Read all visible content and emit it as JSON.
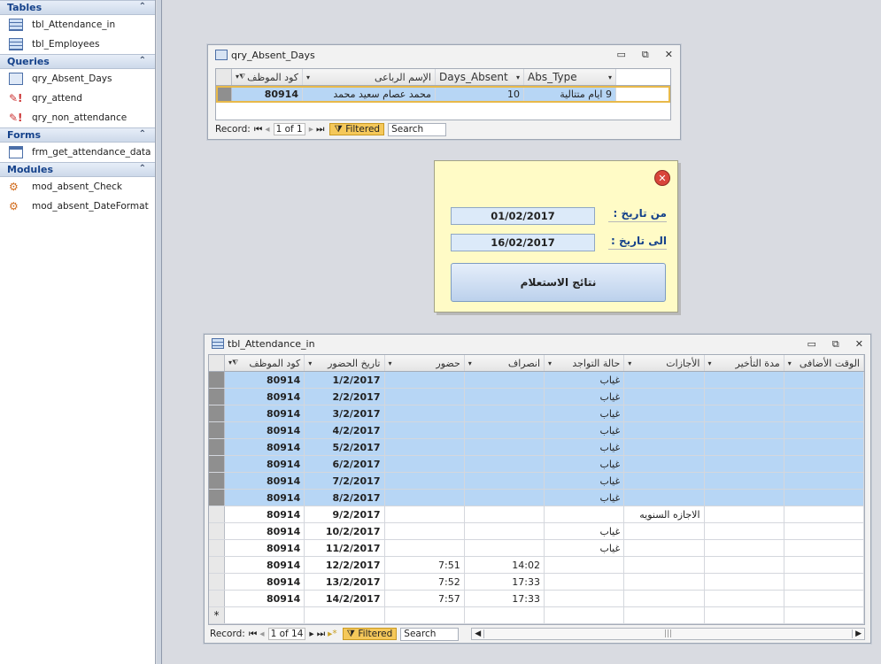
{
  "nav": {
    "tables_header": "Tables",
    "tables": [
      "tbl_Attendance_in",
      "tbl_Employees"
    ],
    "queries_header": "Queries",
    "queries": [
      "qry_Absent_Days",
      "qry_attend",
      "qry_non_attendance"
    ],
    "forms_header": "Forms",
    "forms": [
      "frm_get_attendance_data"
    ],
    "modules_header": "Modules",
    "modules": [
      "mod_absent_Check",
      "mod_absent_DateFormat"
    ]
  },
  "query_window": {
    "title": "qry_Absent_Days",
    "columns": [
      "كود الموظف",
      "الإسم الرباعى",
      "Days_Absent",
      "Abs_Type"
    ],
    "row": {
      "code": "80914",
      "name": "محمد عصام سعيد محمد",
      "days": "10",
      "type": "9 ايام متتالية"
    },
    "record_label": "Record:",
    "record_pos": "1 of 1",
    "filtered": "Filtered",
    "search": "Search"
  },
  "form": {
    "from_label": "من تاريخ :",
    "from_value": "01/02/2017",
    "to_label": "الى تاريخ :",
    "to_value": "16/02/2017",
    "button": "نتائج الاستعلام"
  },
  "table_window": {
    "title": "tbl_Attendance_in",
    "columns": [
      "كود الموظف",
      "تاريخ الحضور",
      "حضور",
      "انصراف",
      "حالة التواجد",
      "الأجازات",
      "مدة التأخير",
      "الوقت الأضافى"
    ],
    "rows": [
      {
        "code": "80914",
        "date": "1/2/2017",
        "in": "",
        "out": "",
        "status": "غياب",
        "leave": "",
        "sel": true
      },
      {
        "code": "80914",
        "date": "2/2/2017",
        "in": "",
        "out": "",
        "status": "غياب",
        "leave": "",
        "sel": true
      },
      {
        "code": "80914",
        "date": "3/2/2017",
        "in": "",
        "out": "",
        "status": "غياب",
        "leave": "",
        "sel": true
      },
      {
        "code": "80914",
        "date": "4/2/2017",
        "in": "",
        "out": "",
        "status": "غياب",
        "leave": "",
        "sel": true
      },
      {
        "code": "80914",
        "date": "5/2/2017",
        "in": "",
        "out": "",
        "status": "غياب",
        "leave": "",
        "sel": true
      },
      {
        "code": "80914",
        "date": "6/2/2017",
        "in": "",
        "out": "",
        "status": "غياب",
        "leave": "",
        "sel": true
      },
      {
        "code": "80914",
        "date": "7/2/2017",
        "in": "",
        "out": "",
        "status": "غياب",
        "leave": "",
        "sel": true
      },
      {
        "code": "80914",
        "date": "8/2/2017",
        "in": "",
        "out": "",
        "status": "غياب",
        "leave": "",
        "sel": true
      },
      {
        "code": "80914",
        "date": "9/2/2017",
        "in": "",
        "out": "",
        "status": "",
        "leave": "الاجازه السنويه",
        "sel": false
      },
      {
        "code": "80914",
        "date": "10/2/2017",
        "in": "",
        "out": "",
        "status": "غياب",
        "leave": "",
        "sel": false
      },
      {
        "code": "80914",
        "date": "11/2/2017",
        "in": "",
        "out": "",
        "status": "غياب",
        "leave": "",
        "sel": false
      },
      {
        "code": "80914",
        "date": "12/2/2017",
        "in": "7:51",
        "out": "14:02",
        "status": "",
        "leave": "",
        "sel": false
      },
      {
        "code": "80914",
        "date": "13/2/2017",
        "in": "7:52",
        "out": "17:33",
        "status": "",
        "leave": "",
        "sel": false
      },
      {
        "code": "80914",
        "date": "14/2/2017",
        "in": "7:57",
        "out": "17:33",
        "status": "",
        "leave": "",
        "sel": false
      }
    ],
    "new_row_marker": "*",
    "record_label": "Record:",
    "record_pos": "1 of 14",
    "filtered": "Filtered",
    "search": "Search"
  }
}
